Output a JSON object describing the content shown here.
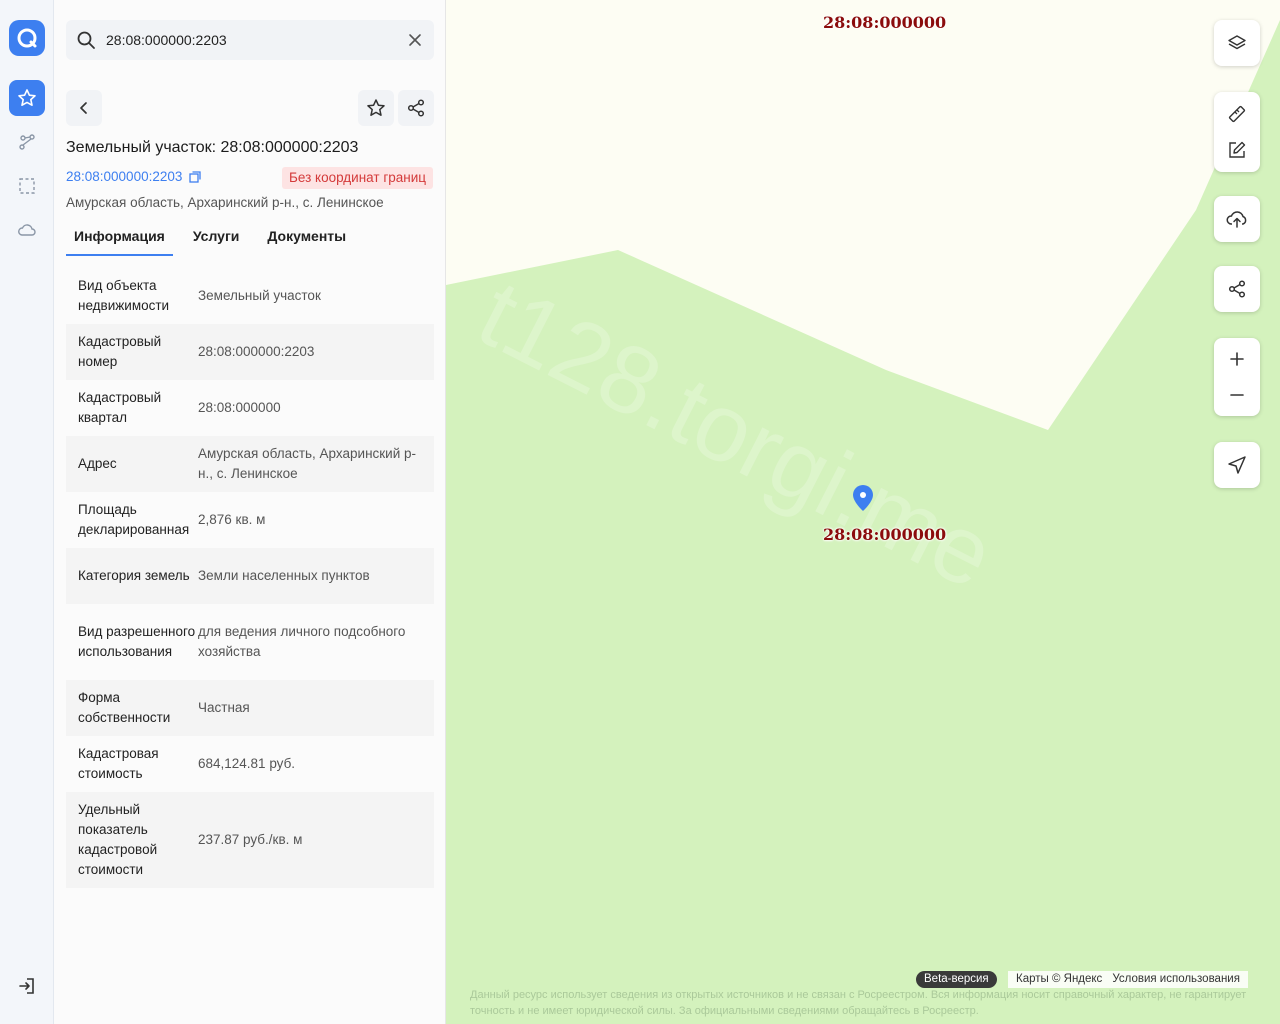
{
  "rail": {
    "items": [
      "logo",
      "favorites",
      "route",
      "selection",
      "cloud",
      "logout"
    ]
  },
  "search": {
    "value": "28:08:000000:2203"
  },
  "card": {
    "title": "Земельный участок: 28:08:000000:2203",
    "cadastral_link": "28:08:000000:2203",
    "badge": "Без координат границ",
    "address": "Амурская область, Архаринский р-н., с. Ленинское",
    "tabs": [
      {
        "label": "Информация",
        "active": true
      },
      {
        "label": "Услуги",
        "active": false
      },
      {
        "label": "Документы",
        "active": false
      }
    ],
    "rows": [
      {
        "label": "Вид объекта недвижимости",
        "value": "Земельный участок"
      },
      {
        "label": "Кадастровый номер",
        "value": "28:08:000000:2203"
      },
      {
        "label": "Кадастровый квартал",
        "value": "28:08:000000"
      },
      {
        "label": "Адрес",
        "value": "Амурская область, Архаринский р-н., с. Ленинское"
      },
      {
        "label": "Площадь декларированная",
        "value": "2,876 кв. м"
      },
      {
        "label": "Категория земель",
        "value": "Земли населенных пунктов"
      },
      {
        "label": "Вид разрешенного использования",
        "value": "для ведения личного подсобного хозяйства"
      },
      {
        "label": "Форма собственности",
        "value": "Частная"
      },
      {
        "label": "Кадастровая стоимость",
        "value": "684,124.81 руб."
      },
      {
        "label": "Удельный показатель кадастровой стоимости",
        "value": "237.87 руб./кв. м"
      }
    ]
  },
  "map": {
    "quarter_label_top": "28:08:000000",
    "quarter_label_center": "28:08:000000",
    "watermark": "t128.torgi.me",
    "beta": "Beta-версия",
    "attribution": "Карты © Яндекс",
    "terms": "Условия использования",
    "disclaimer": "Данный ресурс использует сведения из открытых источников и не связан с Росреестром. Вся информация носит справочный характер, не гарантирует точность и не имеет юридической силы. За официальными сведениями обращайтесь в Росреестр.",
    "colors": {
      "forest": "#d4f2bd",
      "field": "#fdfdf3",
      "accent": "#3d7ff0",
      "label": "#8b0c0c"
    }
  }
}
